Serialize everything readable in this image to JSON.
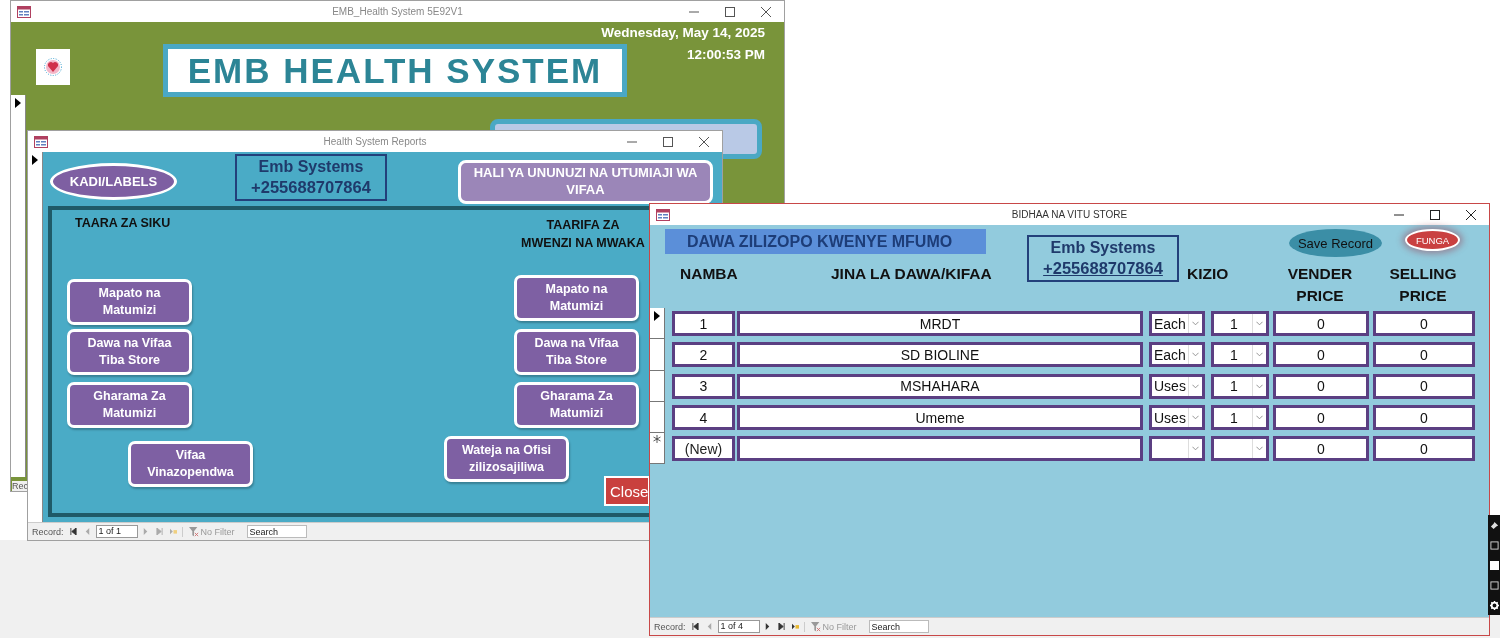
{
  "main_window": {
    "title": "EMB_Health System 5E92V1",
    "date": "Wednesday, May 14, 2025",
    "time": "12:00:53 PM",
    "banner": "EMB HEALTH SYSTEM",
    "status_text": "Rec"
  },
  "reports_window": {
    "title": "Health System Reports",
    "labels_button": "KADI/LABELS",
    "brand": {
      "name": "Emb Systems",
      "phone": "+255688707864"
    },
    "status_button": "HALI YA UNUNUZI NA UTUMIAJI WA VIFAA",
    "daily_heading": "TAARA ZA SIKU",
    "monthly_heading": "TAARIFA ZA\nMWENZI NA MWAKA",
    "daily_buttons": [
      "Mapato na\nMatumizi",
      "Dawa na Vifaa\nTiba Store",
      "Gharama Za\nMatumizi"
    ],
    "monthly_buttons": [
      "Mapato na\nMatumizi",
      "Dawa na Vifaa\nTiba Store",
      "Gharama Za\nMatumizi"
    ],
    "bottom_buttons": [
      "Vifaa\nVinazopendwa",
      "Wateja na Ofisi\nzilizosajiliwa"
    ],
    "close_button": "Close",
    "record_bar": {
      "label": "Record:",
      "position": "1 of 1",
      "filter": "No Filter",
      "search_placeholder": "Search"
    }
  },
  "store_window": {
    "title": "BIDHAA NA VITU STORE",
    "heading": "DAWA ZILIZOPO KWENYE MFUMO",
    "brand": {
      "name": "Emb Systems",
      "phone": "+255688707864"
    },
    "save_button": "Save Record",
    "close_button": "FUNGA",
    "columns": [
      "NAMBA",
      "JINA LA DAWA/KIFAA",
      "KIZIO",
      "VENDER\nPRICE",
      "SELLING\nPRICE"
    ],
    "rows": [
      {
        "kind": "record",
        "selected": true,
        "number": "1",
        "name": "MRDT",
        "unit": "Each",
        "quantity": "1",
        "vender_price": "0",
        "selling_price": "0"
      },
      {
        "kind": "record",
        "selected": false,
        "number": "2",
        "name": "SD BIOLINE",
        "unit": "Each",
        "quantity": "1",
        "vender_price": "0",
        "selling_price": "0"
      },
      {
        "kind": "record",
        "selected": false,
        "number": "3",
        "name": "MSHAHARA",
        "unit": "Uses",
        "quantity": "1",
        "vender_price": "0",
        "selling_price": "0"
      },
      {
        "kind": "record",
        "selected": false,
        "number": "4",
        "name": "Umeme",
        "unit": "Uses",
        "quantity": "1",
        "vender_price": "0",
        "selling_price": "0"
      },
      {
        "kind": "new",
        "selected": false,
        "number": "(New)",
        "vender_price": "0",
        "selling_price": "0"
      }
    ],
    "record_bar": {
      "label": "Record:",
      "position": "1 of 4",
      "filter": "No Filter",
      "search_placeholder": "Search"
    }
  }
}
